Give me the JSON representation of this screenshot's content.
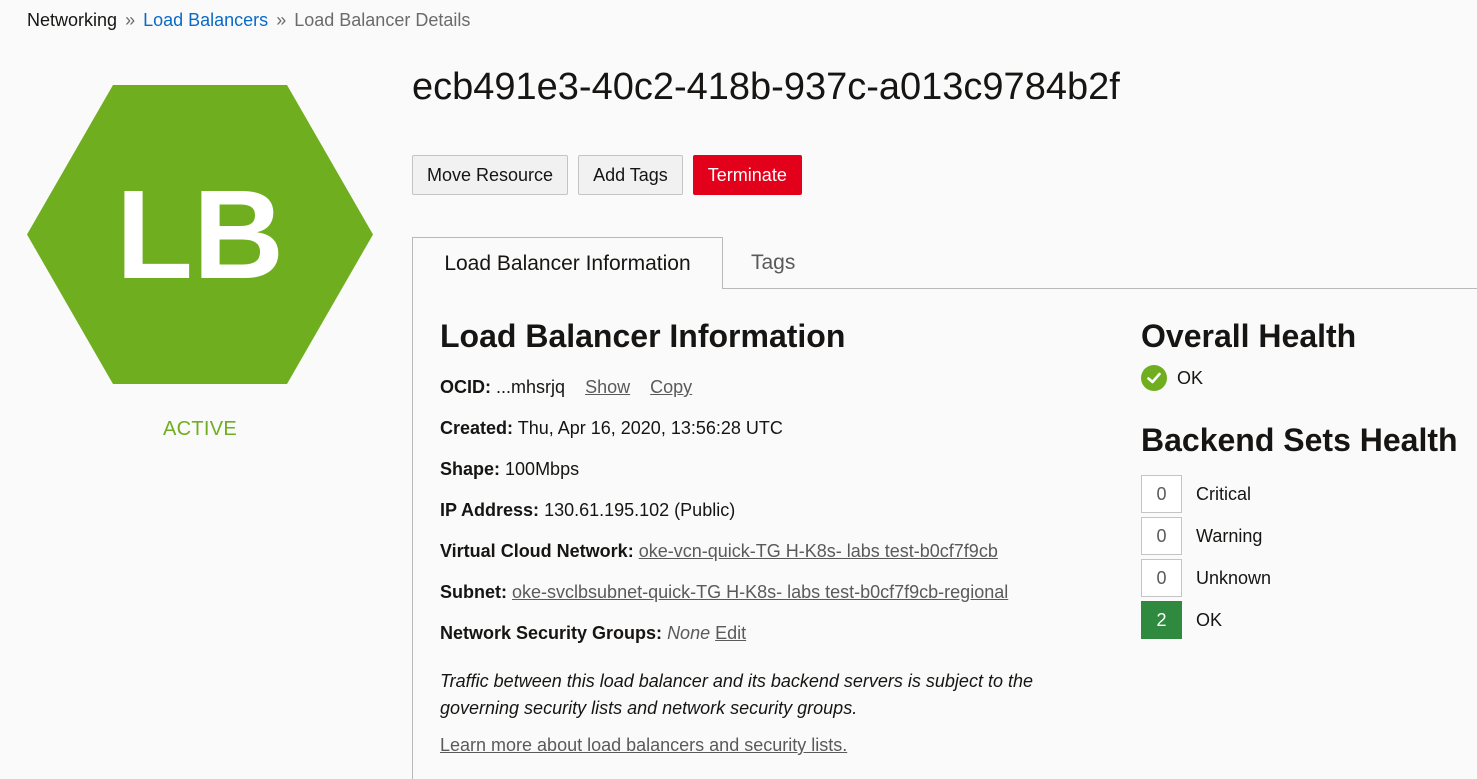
{
  "breadcrumb": {
    "root": "Networking",
    "separator": "»",
    "parent": "Load Balancers",
    "current": "Load Balancer Details"
  },
  "resource": {
    "icon_text": "LB",
    "status": "ACTIVE",
    "title": "ecb491e3-40c2-418b-937c-a013c9784b2f"
  },
  "actions": {
    "move_label": "Move Resource",
    "add_tags_label": "Add Tags",
    "terminate_label": "Terminate"
  },
  "tabs": [
    {
      "label": "Load Balancer Information",
      "active": true
    },
    {
      "label": "Tags",
      "active": false
    }
  ],
  "info": {
    "heading": "Load Balancer Information",
    "ocid_label": "OCID:",
    "ocid_value": "...mhsrjq",
    "show_label": "Show",
    "copy_label": "Copy",
    "created_label": "Created:",
    "created_value": "Thu, Apr 16, 2020, 13:56:28 UTC",
    "shape_label": "Shape:",
    "shape_value": "100Mbps",
    "ip_label": "IP Address:",
    "ip_value": "130.61.195.102 (Public)",
    "vcn_label": "Virtual Cloud Network:",
    "vcn_value": "oke-vcn-quick-TG H-K8s- labs test-b0cf7f9cb",
    "subnet_label": "Subnet:",
    "subnet_value": "oke-svclbsubnet-quick-TG H-K8s- labs test-b0cf7f9cb-regional",
    "nsg_label": "Network Security Groups:",
    "nsg_value": "None",
    "nsg_edit": "Edit",
    "note": "Traffic between this load balancer and its backend servers is subject to the governing security lists and network security groups.",
    "learn_more": "Learn more about load balancers and security lists."
  },
  "health": {
    "overall_heading": "Overall Health",
    "overall_status": "OK",
    "backend_heading": "Backend Sets Health",
    "backend_sets": [
      {
        "count": "0",
        "label": "Critical"
      },
      {
        "count": "0",
        "label": "Warning"
      },
      {
        "count": "0",
        "label": "Unknown"
      },
      {
        "count": "2",
        "label": "OK"
      }
    ]
  },
  "colors": {
    "accent_green": "#6fae1e",
    "terminate_red": "#e3001b",
    "ok_badge": "#2f8a3f",
    "link_blue": "#0a6ac7"
  }
}
